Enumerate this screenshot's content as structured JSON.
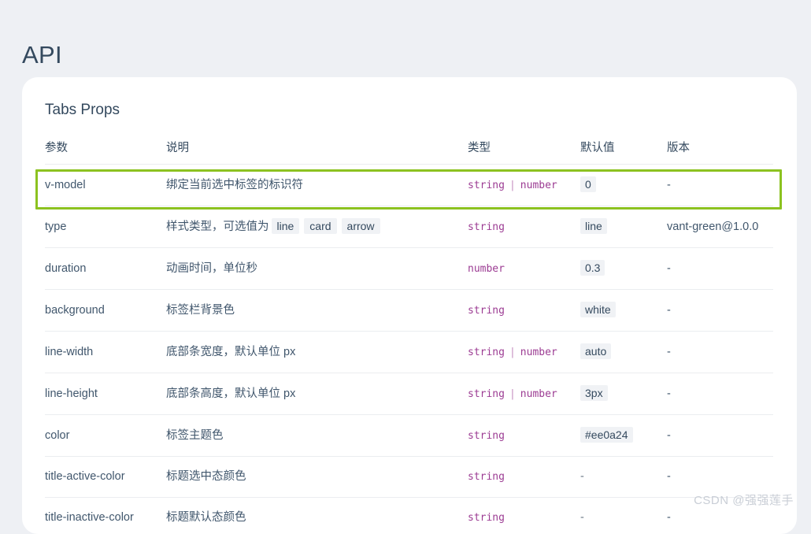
{
  "page": {
    "title": "API",
    "background_color": "#eef0f4"
  },
  "card": {
    "heading": "Tabs Props",
    "background_color": "#ffffff"
  },
  "highlight": {
    "color": "#8cc220",
    "target_row": "v-model"
  },
  "table": {
    "headers": [
      "参数",
      "说明",
      "类型",
      "默认值",
      "版本"
    ],
    "rows": [
      {
        "name": "v-model",
        "desc_parts": [
          {
            "text": "绑定当前选中标签的标识符",
            "code": false
          }
        ],
        "types": [
          "string",
          "number"
        ],
        "default": "0",
        "default_is_code": true,
        "version": "-",
        "highlighted": true
      },
      {
        "name": "type",
        "desc_parts": [
          {
            "text": "样式类型，可选值为",
            "code": false
          },
          {
            "text": "line",
            "code": true
          },
          {
            "text": "card",
            "code": true
          },
          {
            "text": "arrow",
            "code": true
          }
        ],
        "types": [
          "string"
        ],
        "default": "line",
        "default_is_code": true,
        "version": "vant-green@1.0.0",
        "highlighted": false
      },
      {
        "name": "duration",
        "desc_parts": [
          {
            "text": "动画时间，单位秒",
            "code": false
          }
        ],
        "types": [
          "number"
        ],
        "default": "0.3",
        "default_is_code": true,
        "version": "-",
        "highlighted": false
      },
      {
        "name": "background",
        "desc_parts": [
          {
            "text": "标签栏背景色",
            "code": false
          }
        ],
        "types": [
          "string"
        ],
        "default": "white",
        "default_is_code": true,
        "version": "-",
        "highlighted": false
      },
      {
        "name": "line-width",
        "desc_parts": [
          {
            "text": "底部条宽度，默认单位 px",
            "code": false
          }
        ],
        "types": [
          "string",
          "number"
        ],
        "default": "auto",
        "default_is_code": true,
        "version": "-",
        "highlighted": false
      },
      {
        "name": "line-height",
        "desc_parts": [
          {
            "text": "底部条高度，默认单位 px",
            "code": false
          }
        ],
        "types": [
          "string",
          "number"
        ],
        "default": "3px",
        "default_is_code": true,
        "version": "-",
        "highlighted": false
      },
      {
        "name": "color",
        "desc_parts": [
          {
            "text": "标签主题色",
            "code": false
          }
        ],
        "types": [
          "string"
        ],
        "default": "#ee0a24",
        "default_is_code": true,
        "version": "-",
        "highlighted": false
      },
      {
        "name": "title-active-color",
        "desc_parts": [
          {
            "text": "标题选中态颜色",
            "code": false
          }
        ],
        "types": [
          "string"
        ],
        "default": "-",
        "default_is_code": false,
        "version": "-",
        "highlighted": false
      },
      {
        "name": "title-inactive-color",
        "desc_parts": [
          {
            "text": "标题默认态颜色",
            "code": false
          }
        ],
        "types": [
          "string"
        ],
        "default": "-",
        "default_is_code": false,
        "version": "-",
        "highlighted": false
      }
    ]
  },
  "watermark": {
    "text": "CSDN @强强莲手"
  }
}
